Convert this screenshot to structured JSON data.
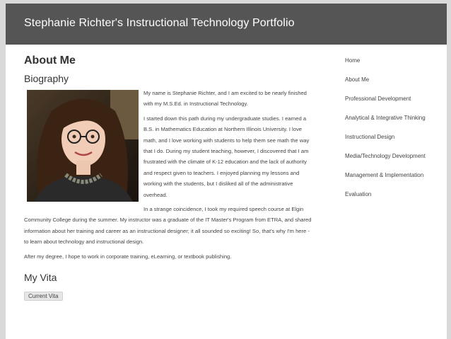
{
  "header": {
    "site_title": "Stephanie Richter's Instructional Technology Portfolio"
  },
  "main": {
    "page_title": "About Me",
    "section_title": "Biography",
    "paragraphs": [
      "My name is Stephanie Richter, and I am excited to be nearly finished with my M.S.Ed. in Instructional Technology.",
      "I started down this path during my undergraduate studies. I earned a B.S. in Mathematics Education at Northern Illinois University. I love math, and I love working with students to help them see math the way that I do. During my student teaching, however, I discovered that I am frustrated with the climate of K-12 education and the lack of authority and respect given to teachers. I enjoyed planning my lessons and working with the students, but I disliked all of the administrative overhead.",
      "In a strange coincidence, I took my required speech course at Elgin Community College during the summer. My instructor was a graduate of the IT Master's Program from ETRA, and shared information about her training and career as an instructional designer; it all sounded so exciting! So, that's why I'm here - to learn about technology and instructional design.",
      "After my degree, I hope to work in corporate training, eLearning, or textbook publishing."
    ],
    "vita_title": "My Vita",
    "vita_button": "Current Vita"
  },
  "nav": {
    "items": [
      {
        "label": "Home"
      },
      {
        "label": "About Me"
      },
      {
        "label": "Professional Development"
      },
      {
        "label": "Analytical & Integrative Thinking"
      },
      {
        "label": "Instructional Design"
      },
      {
        "label": "Media/Technology Development"
      },
      {
        "label": "Management & Implementation"
      },
      {
        "label": "Evaluation"
      }
    ]
  },
  "colors": {
    "header_bg": "#555555",
    "page_bg": "#ffffff",
    "outer_bg": "#d9d9d9",
    "text": "#444444"
  }
}
